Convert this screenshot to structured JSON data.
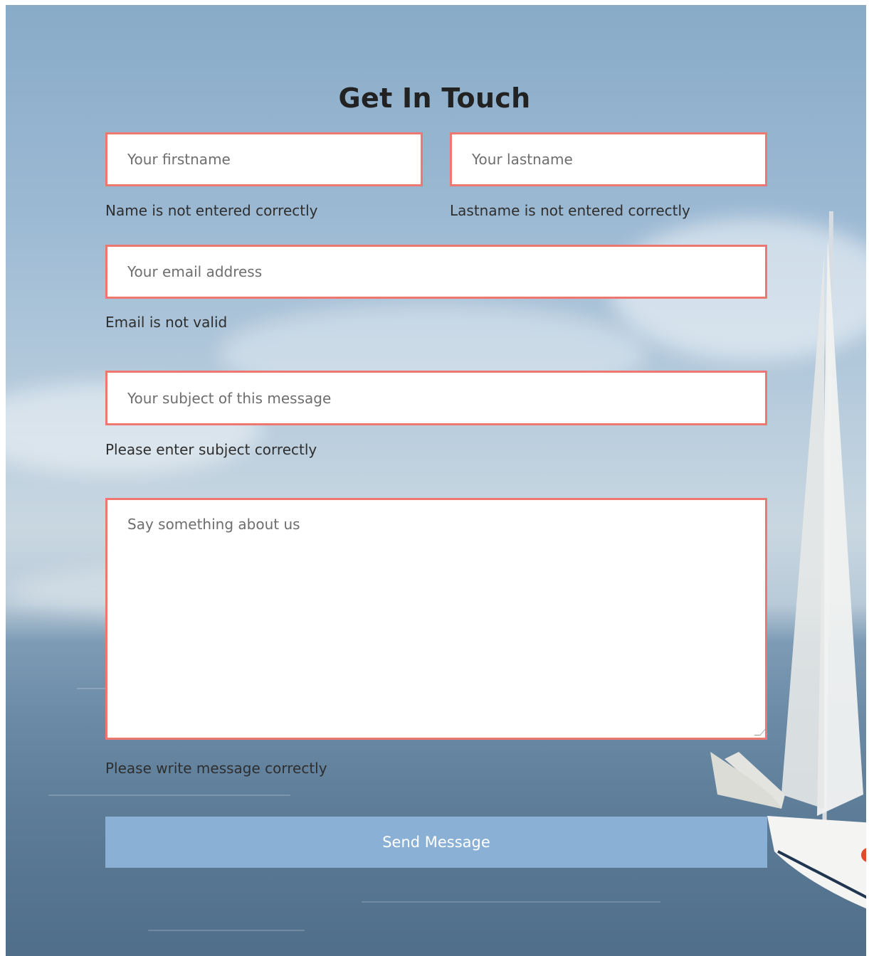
{
  "form": {
    "title": "Get In Touch",
    "firstname": {
      "placeholder": "Your firstname",
      "value": "",
      "error": "Name is not entered correctly"
    },
    "lastname": {
      "placeholder": "Your lastname",
      "value": "",
      "error": "Lastname is not entered correctly"
    },
    "email": {
      "placeholder": "Your email address",
      "value": "",
      "error": "Email is not valid"
    },
    "subject": {
      "placeholder": "Your subject of this message",
      "value": "",
      "error": "Please enter subject correctly"
    },
    "message": {
      "placeholder": "Say something about us",
      "value": "",
      "error": "Please write message correctly"
    },
    "submit_label": "Send Message"
  },
  "colors": {
    "error_border": "#ef7772",
    "button_bg": "#8ab1d5",
    "title_text": "#222222"
  }
}
